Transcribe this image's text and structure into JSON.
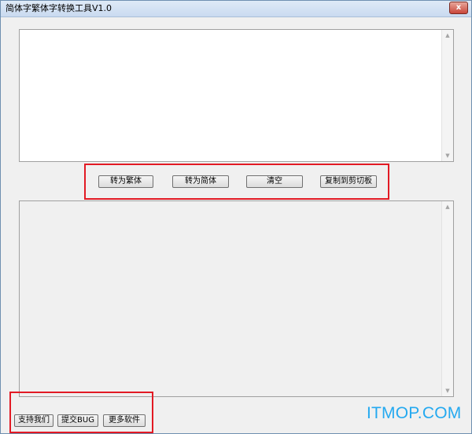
{
  "window": {
    "title": "简体字繁体字转换工具V1.0",
    "close_glyph": "x"
  },
  "editor": {
    "input_value": "",
    "output_value": "",
    "scroll_up_glyph": "▲",
    "scroll_down_glyph": "▼"
  },
  "actions": {
    "to_traditional": "转为繁体",
    "to_simplified": "转为简体",
    "clear": "清空",
    "copy_clipboard": "复制到剪切板"
  },
  "footer": {
    "support": "支持我们",
    "submit_bug": "提交BUG",
    "more_software": "更多软件"
  },
  "watermark": {
    "text": "ITMOP.COM",
    "color": "#24a9f0"
  },
  "colors": {
    "highlight": "#e21a24",
    "titlebar": "#c9daf0"
  },
  "icons": {
    "close": "close-icon",
    "scroll_up": "scroll-up-arrow-icon",
    "scroll_down": "scroll-down-arrow-icon"
  }
}
